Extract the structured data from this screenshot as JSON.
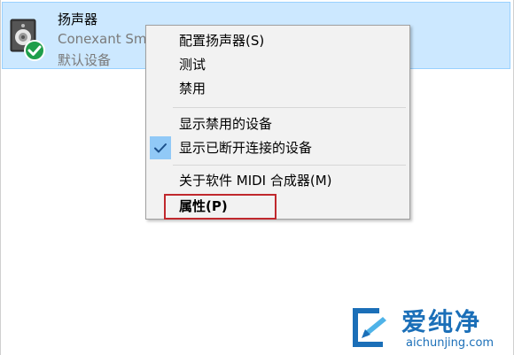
{
  "device": {
    "name": "扬声器",
    "driver": "Conexant Sm",
    "status": "默认设备"
  },
  "menu": {
    "items": [
      {
        "label": "配置扬声器(S)"
      },
      {
        "label": "测试"
      },
      {
        "label": "禁用"
      },
      {
        "label": "显示禁用的设备"
      },
      {
        "label": "显示已断开连接的设备",
        "checked": true
      },
      {
        "label": "关于软件 MIDI 合成器(M)"
      },
      {
        "label": "属性(P)",
        "highlighted": true
      }
    ]
  },
  "watermark": {
    "title": "爱纯净",
    "url": "aichunjing.com"
  },
  "colors": {
    "selection": "#cce8ff",
    "check_bg": "#91c9f7",
    "highlight_border": "#c0282d",
    "watermark": "#1b6fb8"
  }
}
